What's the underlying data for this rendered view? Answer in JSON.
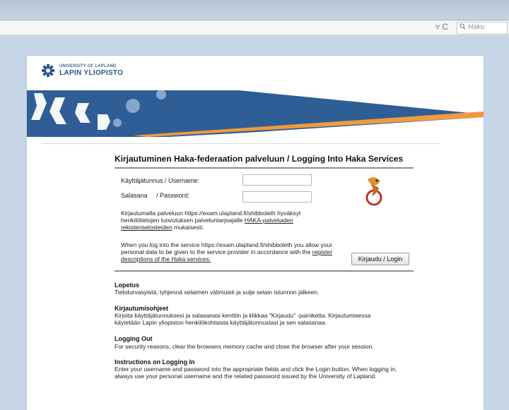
{
  "browser": {
    "search_placeholder": "Haku"
  },
  "logo": {
    "top": "UNIVERSITY OF LAPLAND",
    "bottom": "LAPIN YLIOPISTO"
  },
  "login": {
    "title": "Kirjautuminen Haka-federaation palveluun / Logging Into Haka Services",
    "username_label": "Käyttäjätunnus / Username:",
    "password_label_fi": "Salasana",
    "password_label_en": "/ Password:",
    "username_value": "",
    "password_value": "",
    "fi_notice": {
      "line1": "Kirjautumalla palveluun https://exam.ulapland.fi/shibboleth hyväksyt",
      "line2_text": "henkilötietojen luovutuksen palveluntarjoajalle ",
      "line2_link": "HAKA-palveluiden",
      "line3_link": "rekisteriselosteiden",
      "line3_text": " mukaisesti."
    },
    "en_notice": {
      "line1": "When you log into the service https://exam.ulapland.fi/shibboleth you allow your",
      "line2_text": "personal data to be given to the service provider in accordance with the ",
      "line2_link": "register",
      "line3_link": "descriptions of the Haka services."
    },
    "login_button": "Kirjaudu / Login"
  },
  "info": [
    {
      "heading": "Lopetus",
      "lines": [
        "Tietoturvasyistä, tyhjennä selaimen välimuisti ja sulje selain istunnon jälkeen."
      ]
    },
    {
      "heading": "Kirjautumisohjeet",
      "lines": [
        "Kirjoita käyttäjätunnuksesi ja salasanasi kenttiin ja klikkaa \"Kirjaudu\" -painiketta. Kirjautumisessa",
        "käytetään Lapin yliopiston henkilökohtaista käyttäjätunnustasi ja sen salasanaa."
      ]
    },
    {
      "heading": "Logging Out",
      "lines": [
        "For security reasons, clear the browsers memory cache and close the browser after your session."
      ]
    },
    {
      "heading": "Instructions on Logging In",
      "lines": [
        "Enter your username and password into the appropriate fields and click the Login button. When logging in,",
        "always use your personal username and the related password issued by the University of Lapland."
      ]
    }
  ],
  "colors": {
    "banner_blue": "#2f5d96",
    "banner_orange": "#f09a3e",
    "logo_blue": "#2f5487"
  }
}
